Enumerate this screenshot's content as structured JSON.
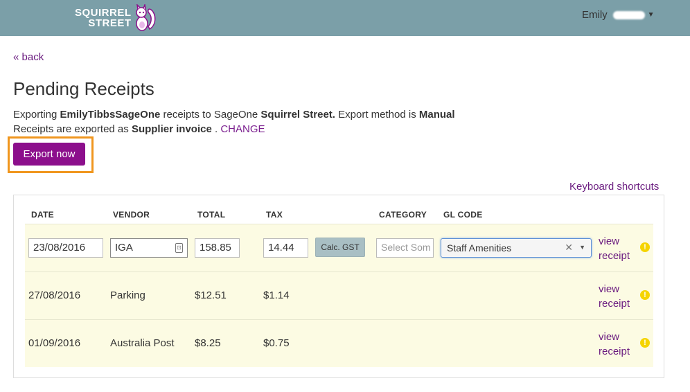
{
  "header": {
    "logo_line1": "SQUIRREL",
    "logo_line2": "STREET",
    "user_name": "Emily"
  },
  "nav": {
    "back_label": "« back"
  },
  "page": {
    "title": "Pending Receipts",
    "export_prefix": "Exporting ",
    "export_user": "EmilyTibbsSageOne",
    "export_mid": " receipts to SageOne ",
    "export_org": "Squirrel Street.",
    "export_method_label": " Export method is ",
    "export_method": "Manual",
    "receipts_prefix": "Receipts are exported as ",
    "receipts_type": "Supplier invoice",
    "receipts_suffix": " . ",
    "change_label": "CHANGE",
    "export_button": "Export now",
    "keyboard_shortcuts": "Keyboard shortcuts"
  },
  "table": {
    "columns": [
      "DATE",
      "VENDOR",
      "TOTAL",
      "TAX",
      "CATEGORY",
      "GL CODE"
    ],
    "editing_row": {
      "date": "23/08/2016",
      "vendor": "IGA",
      "total": "158.85",
      "tax": "14.44",
      "calc_gst_label": "Calc. GST",
      "category_placeholder": "Select Som",
      "gl_code": "Staff Amenities",
      "view_line1": "view",
      "view_line2": "receipt"
    },
    "rows": [
      {
        "date": "27/08/2016",
        "vendor": "Parking",
        "total": "$12.51",
        "tax": "$1.14",
        "view_line1": "view",
        "view_line2": "receipt"
      },
      {
        "date": "01/09/2016",
        "vendor": "Australia Post",
        "total": "$8.25",
        "tax": "$0.75",
        "view_line1": "view",
        "view_line2": "receipt"
      }
    ]
  },
  "colors": {
    "topbar": "#7b9fa8",
    "accent_purple": "#8c0f8c",
    "link_purple": "#6a1b7f",
    "highlight_orange": "#f0961e",
    "row_background": "#fcfbe3",
    "warning_yellow": "#f5d400"
  },
  "icons": [
    "squirrel-logo-icon",
    "caret-down-icon",
    "contact-card-icon",
    "clear-icon",
    "dropdown-arrow-icon",
    "warning-icon"
  ]
}
